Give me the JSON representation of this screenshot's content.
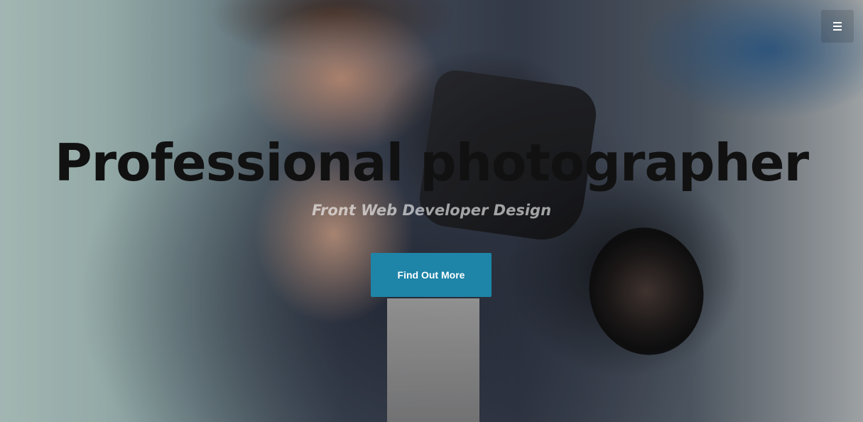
{
  "hero": {
    "title": "Professional photographer",
    "subtitle": "Front Web Developer Design",
    "cta_label": "Find Out More",
    "background_image": "photographer-with-camera"
  },
  "nav": {
    "menu_icon": "hamburger-menu-icon"
  },
  "colors": {
    "cta_background": "#1e84a8",
    "title": "#111111",
    "subtitle": "rgba(255,255,255,0.6)"
  }
}
